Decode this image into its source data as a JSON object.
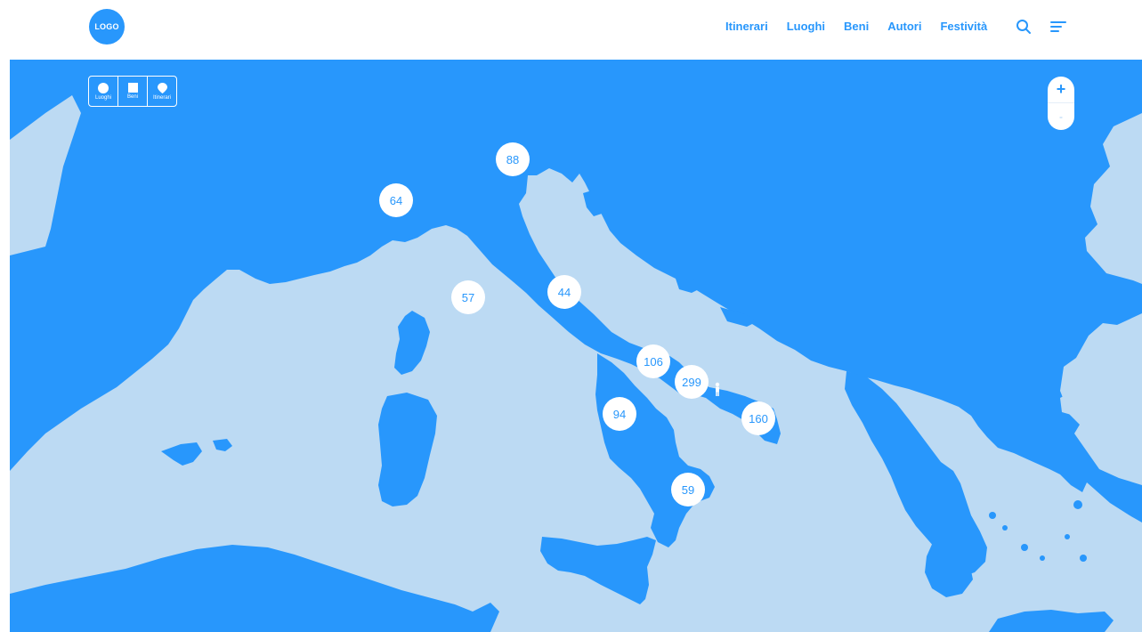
{
  "header": {
    "logo": "LOGO",
    "nav": [
      "Itinerari",
      "Luoghi",
      "Beni",
      "Autori",
      "Festività"
    ],
    "icons": [
      "search-icon",
      "menu-icon"
    ]
  },
  "map": {
    "filters": [
      {
        "label": "Luoghi",
        "icon": "circle-icon"
      },
      {
        "label": "Beni",
        "icon": "square-icon"
      },
      {
        "label": "Itinerari",
        "icon": "pin-icon"
      }
    ],
    "zoom": {
      "in": "+",
      "out": "-"
    },
    "clusters": [
      "88",
      "64",
      "57",
      "44",
      "106",
      "299",
      "94",
      "160",
      "59"
    ]
  },
  "colors": {
    "accent": "#2897fc",
    "sea": "#bcdaf3",
    "land": "#2897fc",
    "white": "#ffffff"
  }
}
